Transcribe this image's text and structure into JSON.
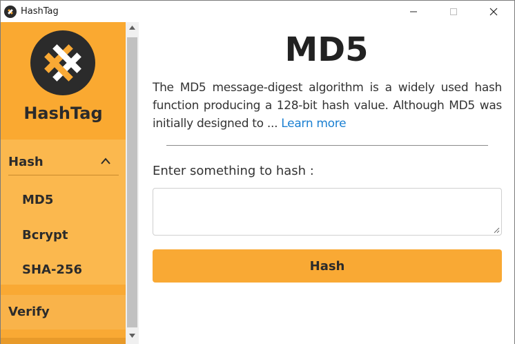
{
  "window": {
    "title": "HashTag",
    "icon": "hashtag-logo-icon",
    "controls": [
      "minimize-icon",
      "maximize-icon",
      "close-icon"
    ]
  },
  "sidebar": {
    "brand_name": "HashTag",
    "hash_section": {
      "label": "Hash",
      "expanded": true,
      "items": [
        {
          "label": "MD5"
        },
        {
          "label": "Bcrypt"
        },
        {
          "label": "SHA-256"
        }
      ]
    },
    "verify_label": "Verify"
  },
  "main": {
    "title": "MD5",
    "description": "The MD5 message-digest algorithm is a widely used hash function producing a 128-bit hash value. Although MD5 was initially designed to ...",
    "learn_more": "Learn more",
    "input_label": "Enter something to hash :",
    "input_value": "",
    "hash_button": "Hash"
  },
  "colors": {
    "accent": "#f9a934",
    "sidebar_nav": "#fbb84e",
    "link": "#1a7fd1",
    "logo_bg": "#2b2b2b"
  }
}
